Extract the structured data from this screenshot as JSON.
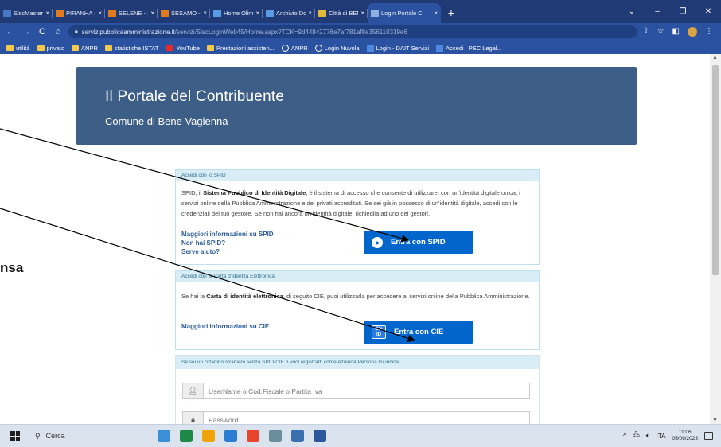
{
  "browser": {
    "tabs": [
      {
        "label": "SiscMasterWeb",
        "color": "#4a78c8"
      },
      {
        "label": "PIRANHA : Ges",
        "color": "#e07b22"
      },
      {
        "label": "SELENE - Servi",
        "color": "#e07b22"
      },
      {
        "label": "SESAMO - Serv",
        "color": "#e07b22"
      },
      {
        "label": "Home Olimpo",
        "color": "#5a9be6"
      },
      {
        "label": "Archivio Docun",
        "color": "#5a9be6"
      },
      {
        "label": "Città di BENE V",
        "color": "#e2b73a"
      },
      {
        "label": "Login Portale C",
        "color": "#8fb0e0",
        "active": true
      }
    ],
    "tab_close": "×",
    "new_tab": "+",
    "window_controls": [
      "⌄",
      "–",
      "❐",
      "✕"
    ],
    "nav": {
      "back": "←",
      "forward": "→",
      "reload": "C",
      "home": "⌂"
    },
    "url_host": "servizipubblicaamministrazione.it",
    "url_path": "/servizi/SiscLoginWeb45/Home.aspx?TCK=9d44842776e7af781af8e356110319e6",
    "bookmarks": [
      {
        "label": "utilità",
        "icon": "folder-icon"
      },
      {
        "label": "privato",
        "icon": "folder-icon"
      },
      {
        "label": "ANPR",
        "icon": "folder-icon"
      },
      {
        "label": "statistiche ISTAT",
        "icon": "folder-icon"
      },
      {
        "label": "YouTube",
        "icon": "youtube-icon"
      },
      {
        "label": "Prestazioni assisten...",
        "icon": "folder-icon"
      },
      {
        "label": "ANPR",
        "icon": "globe-icon"
      },
      {
        "label": "Login Nuvola",
        "icon": "globe-icon"
      },
      {
        "label": "Login - DAIT Servizi",
        "icon": "grid-icon"
      },
      {
        "label": "Accedi | PEC Legal...",
        "icon": "grid-icon"
      }
    ]
  },
  "header": {
    "title": "Il Portale del Contribuente",
    "subtitle": "Comune di Bene Vagienna"
  },
  "spid": {
    "heading": "Accedi con lo SPID",
    "text_pre": "SPID, il ",
    "text_bold": "Sistema Pubblico di Identità Digitale",
    "text_post": ", è il sistema di accesso che consente di utilizzare, con un'identità digitale unica, i servizi online della Pubblica Amministrazione e dei privati accreditati. Se sei già in possesso di un'identità digitale, accedi con le credenziali del tuo gestore. Se non hai ancora un'identità digitale, richiedila ad uno dei gestori.",
    "link_more": "Maggiori informazioni su SPID",
    "link_no": "Non hai SPID?",
    "link_help": "Serve aiuto?",
    "button": "Entra con SPID"
  },
  "cie": {
    "heading": "Accedi con la Carta d'Identità Elettronica:",
    "text_pre": "Se hai la ",
    "text_bold": "Carta di identità elettronica",
    "text_post": ", di seguito CIE, puoi utilizzarla per accedere ai servizi online della Pubblica Amministrazione.",
    "link_more": "Maggiori informazioni su CIE",
    "icon_text": "Cie ID",
    "button": "Entra con CIE"
  },
  "other": {
    "heading": "Se sei un cittadino straniero senza SPID/CIE o vuoi registrarti come Azienda/Persona Giuridica",
    "username_placeholder": "UserName o Cod.Fiscale o Partita Iva",
    "password_placeholder": "Password"
  },
  "partial_text": "nsa",
  "taskbar": {
    "search": "Cerca",
    "lang": "ITA",
    "time": "11:06",
    "date": "05/09/2023",
    "apps": [
      "#3a8fd8",
      "#1c8a46",
      "#f0a30a",
      "#2b7cd3",
      "#e8452e",
      "#6b8e9e",
      "#3a6fb0",
      "#2b579a"
    ]
  }
}
